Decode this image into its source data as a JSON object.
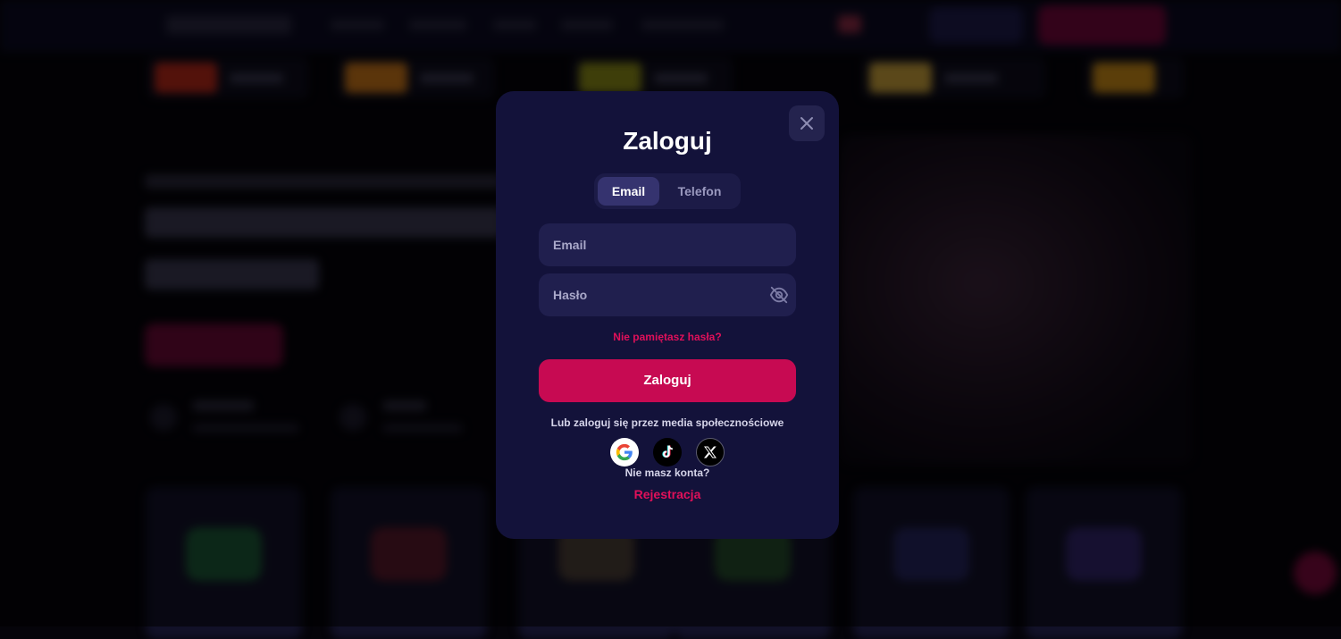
{
  "modal": {
    "title": "Zaloguj",
    "tabs": [
      {
        "label": "Email",
        "active": true
      },
      {
        "label": "Telefon",
        "active": false
      }
    ],
    "email_field": {
      "placeholder": "Email",
      "value": ""
    },
    "password_field": {
      "placeholder": "Hasło",
      "value": ""
    },
    "forgot_password": "Nie pamiętasz hasła?",
    "submit_label": "Zaloguj",
    "social_prompt": "Lub zaloguj się przez media społecznościowe",
    "social_providers": [
      "google-icon",
      "tiktok-icon",
      "x-icon"
    ],
    "no_account_text": "Nie masz konta?",
    "register_link": "Rejestracja"
  },
  "colors": {
    "modal_bg": "#13123a",
    "accent": "#c70a52",
    "link": "#e0105a",
    "field_bg": "#201f4e"
  }
}
